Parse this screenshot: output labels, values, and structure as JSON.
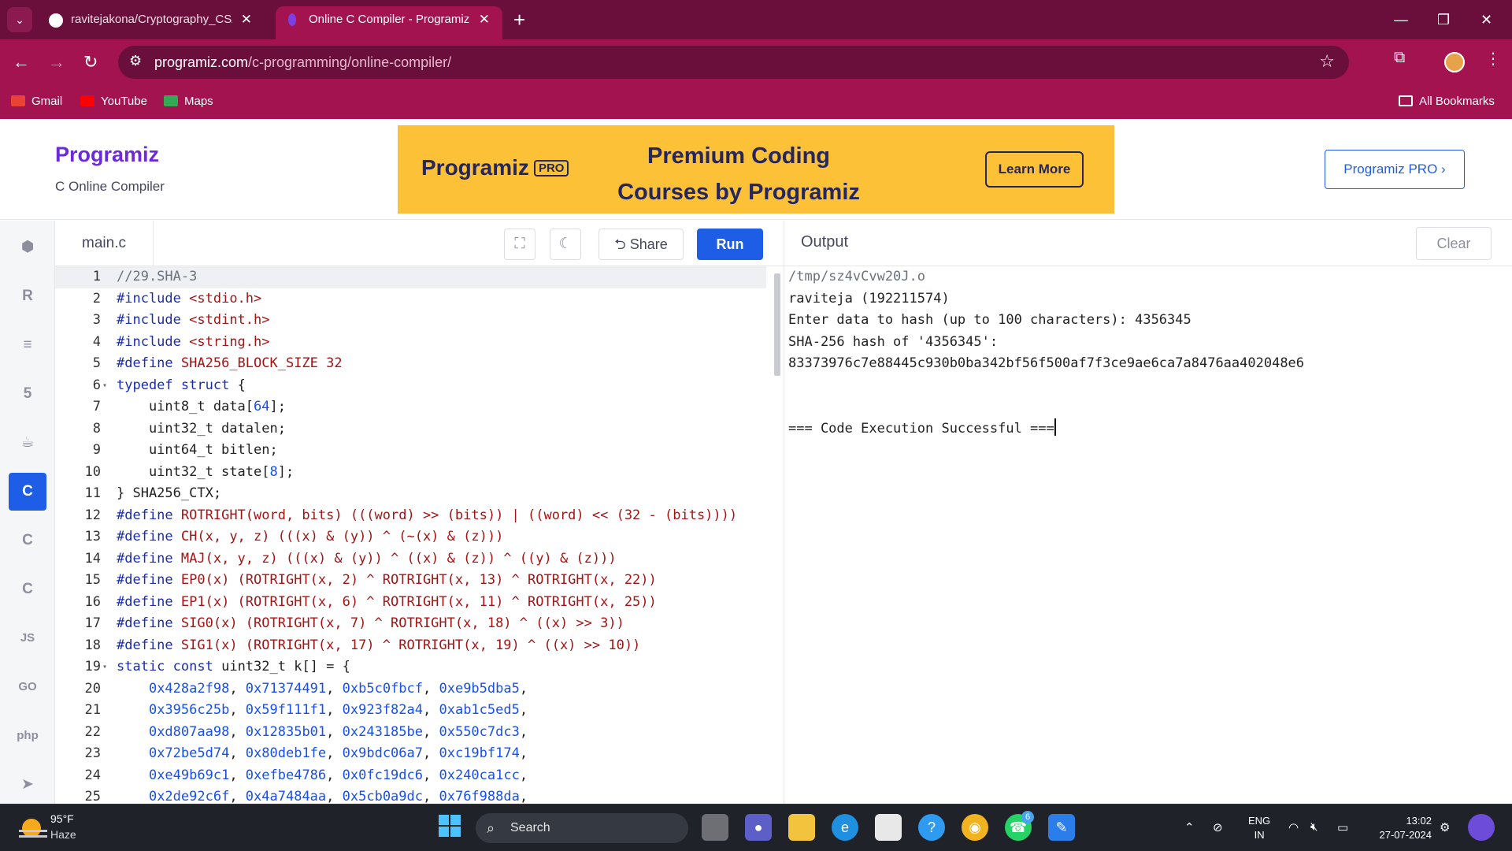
{
  "browser": {
    "tabs": [
      {
        "title": "ravitejakona/Cryptography_CSA",
        "favicon": "github-icon",
        "active": false
      },
      {
        "title": "Online C Compiler - Programiz",
        "favicon": "programiz-icon",
        "active": true
      }
    ],
    "url_domain": "programiz.com",
    "url_path": "/c-programming/online-compiler/",
    "bookmarks": [
      {
        "label": "Gmail",
        "icon": "gmail-icon"
      },
      {
        "label": "YouTube",
        "icon": "youtube-icon"
      },
      {
        "label": "Maps",
        "icon": "maps-icon"
      }
    ],
    "all_bookmarks": "All Bookmarks"
  },
  "header": {
    "logo": "Programiz",
    "subtitle": "C Online Compiler",
    "banner_logo": "Programiz",
    "banner_pro": "PRO",
    "banner_line1": "Premium Coding",
    "banner_line2": "Courses by Programiz",
    "banner_button": "Learn More",
    "pro_button": "Programiz PRO ›"
  },
  "languages": [
    {
      "name": "python-icon",
      "glyph": "⬢"
    },
    {
      "name": "r-icon",
      "glyph": "R"
    },
    {
      "name": "sql-icon",
      "glyph": "≡"
    },
    {
      "name": "html-icon",
      "glyph": "5"
    },
    {
      "name": "java-icon",
      "glyph": "☕"
    },
    {
      "name": "c-icon",
      "glyph": "C",
      "active": true
    },
    {
      "name": "cpp-icon",
      "glyph": "C"
    },
    {
      "name": "csharp-icon",
      "glyph": "C"
    },
    {
      "name": "js-icon",
      "glyph": "JS"
    },
    {
      "name": "go-icon",
      "glyph": "GO"
    },
    {
      "name": "php-icon",
      "glyph": "php"
    },
    {
      "name": "swift-icon",
      "glyph": "➤"
    }
  ],
  "editor": {
    "filename": "main.c",
    "share_label": "Share",
    "run_label": "Run",
    "lines": [
      "//29.SHA-3",
      "#include <stdio.h>",
      "#include <stdint.h>",
      "#include <string.h>",
      "#define SHA256_BLOCK_SIZE 32",
      "typedef struct {",
      "    uint8_t data[64];",
      "    uint32_t datalen;",
      "    uint64_t bitlen;",
      "    uint32_t state[8];",
      "} SHA256_CTX;",
      "#define ROTRIGHT(word, bits) (((word) >> (bits)) | ((word) << (32 - (bits))))",
      "#define CH(x, y, z) (((x) & (y)) ^ (~(x) & (z)))",
      "#define MAJ(x, y, z) (((x) & (y)) ^ ((x) & (z)) ^ ((y) & (z)))",
      "#define EP0(x) (ROTRIGHT(x, 2) ^ ROTRIGHT(x, 13) ^ ROTRIGHT(x, 22))",
      "#define EP1(x) (ROTRIGHT(x, 6) ^ ROTRIGHT(x, 11) ^ ROTRIGHT(x, 25))",
      "#define SIG0(x) (ROTRIGHT(x, 7) ^ ROTRIGHT(x, 18) ^ ((x) >> 3))",
      "#define SIG1(x) (ROTRIGHT(x, 17) ^ ROTRIGHT(x, 19) ^ ((x) >> 10))",
      "static const uint32_t k[] = {",
      "    0x428a2f98, 0x71374491, 0xb5c0fbcf, 0xe9b5dba5,",
      "    0x3956c25b, 0x59f111f1, 0x923f82a4, 0xab1c5ed5,",
      "    0xd807aa98, 0x12835b01, 0x243185be, 0x550c7dc3,",
      "    0x72be5d74, 0x80deb1fe, 0x9bdc06a7, 0xc19bf174,",
      "    0xe49b69c1, 0xefbe4786, 0x0fc19dc6, 0x240ca1cc,",
      "    0x2de92c6f, 0x4a7484aa, 0x5cb0a9dc, 0x76f988da,"
    ],
    "fold_lines": [
      6,
      19
    ]
  },
  "output": {
    "title": "Output",
    "clear_label": "Clear",
    "lines": [
      "/tmp/sz4vCvw20J.o",
      "raviteja (192211574)",
      "Enter data to hash (up to 100 characters): 4356345",
      "SHA-256 hash of '4356345':",
      "83373976c7e88445c930b0ba342bf56f500af7f3ce9ae6ca7a8476aa402048e6",
      "",
      "",
      "=== Code Execution Successful ==="
    ]
  },
  "taskbar": {
    "temperature": "95°F",
    "condition": "Haze",
    "search_label": "Search",
    "lang_line1": "ENG",
    "lang_line2": "IN",
    "time": "13:02",
    "date": "27-07-2024",
    "whatsapp_badge": "6"
  },
  "colors": {
    "chrome_dark": "#6a0f3c",
    "chrome_main": "#a3134f",
    "programiz_blue": "#1e5ee6",
    "banner_yellow": "#fdc137"
  }
}
